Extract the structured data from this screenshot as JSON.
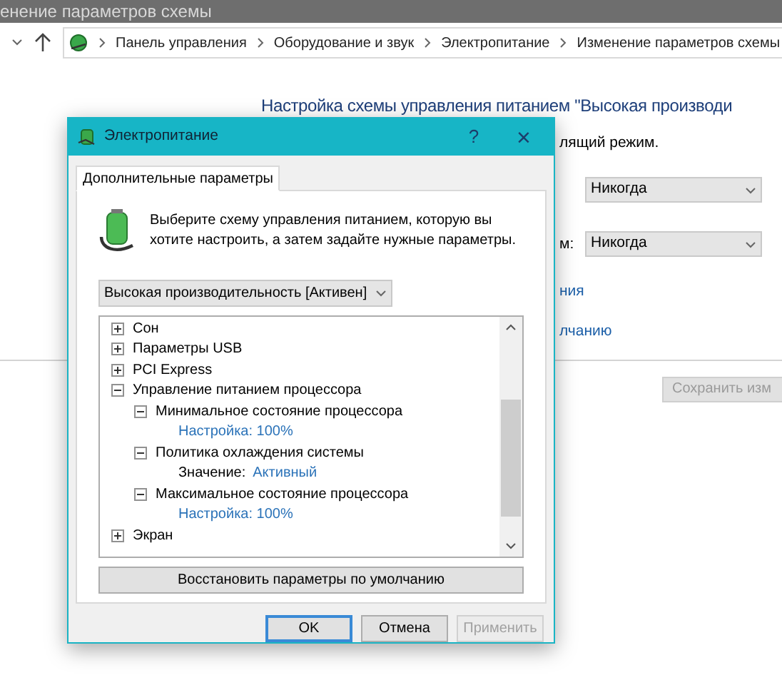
{
  "window": {
    "title": "енение параметров схемы"
  },
  "address_bar": {
    "breadcrumbs": [
      "Панель управления",
      "Оборудование и звук",
      "Электропитание",
      "Изменение параметров схемы"
    ]
  },
  "page": {
    "heading": "Настройка схемы управления питанием \"Высокая производи",
    "partial_text": "лящий режим.",
    "settings": [
      {
        "value": "Никогда"
      },
      {
        "label": "м:",
        "value": "Никогда"
      }
    ],
    "links": [
      "ния",
      "лчанию"
    ],
    "save_button": {
      "label": "Сохранить изм",
      "disabled": true
    }
  },
  "dialog": {
    "title": "Электропитание",
    "help": "?",
    "close": "×",
    "tabs": [
      {
        "label": "Дополнительные параметры",
        "selected": true
      }
    ],
    "prompt": "Выберите схему управления питанием, которую вы хотите настроить, а затем задайте нужные параметры.",
    "plan_select": {
      "value": "Высокая производительность [Активен]"
    },
    "tree": [
      {
        "kind": "group",
        "label": "Сон",
        "expanded": false
      },
      {
        "kind": "group",
        "label": "Параметры USB",
        "expanded": false
      },
      {
        "kind": "group",
        "label": "PCI Express",
        "expanded": false
      },
      {
        "kind": "group",
        "label": "Управление питанием процессора",
        "expanded": true,
        "children": [
          {
            "kind": "group",
            "label": "Минимальное состояние процессора",
            "expanded": true,
            "children": [
              {
                "kind": "link",
                "label": "Настройка: 100%"
              }
            ]
          },
          {
            "kind": "group",
            "label": "Политика охлаждения системы",
            "expanded": true,
            "children": [
              {
                "kind": "value",
                "label": "Значение:",
                "value": "Активный"
              }
            ]
          },
          {
            "kind": "group",
            "label": "Максимальное состояние процессора",
            "expanded": true,
            "children": [
              {
                "kind": "link",
                "label": "Настройка: 100%"
              }
            ]
          }
        ]
      },
      {
        "kind": "group",
        "label": "Экран",
        "expanded": false
      }
    ],
    "restore_button": "Восстановить параметры по умолчанию",
    "buttons": [
      {
        "label": "OK",
        "default": true,
        "disabled": false
      },
      {
        "label": "Отмена",
        "default": false,
        "disabled": false
      },
      {
        "label": "Применить",
        "default": false,
        "disabled": true
      }
    ]
  }
}
